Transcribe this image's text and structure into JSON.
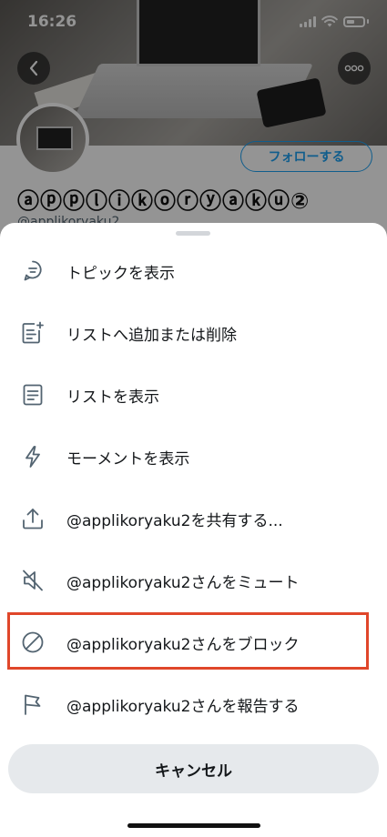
{
  "status_bar": {
    "time": "16:26"
  },
  "profile": {
    "display_name": "ⓐⓟⓟⓛⓘⓚⓞⓡⓨⓐⓚⓤ②",
    "handle": "@applikoryaku2",
    "follow_label": "フォローする",
    "back_icon": "chevron-left-icon",
    "more_icon": "more-horizontal-icon"
  },
  "colors": {
    "accent": "#1da1f2",
    "highlight": "#e0462a",
    "sheet_text": "#14171a",
    "icon_color": "#536471"
  },
  "menu": {
    "items": [
      {
        "label": "トピックを表示",
        "icon": "topic-icon"
      },
      {
        "label": "リストへ追加または削除",
        "icon": "list-add-icon"
      },
      {
        "label": "リストを表示",
        "icon": "list-icon"
      },
      {
        "label": "モーメントを表示",
        "icon": "lightning-icon"
      },
      {
        "label": "@applikoryaku2を共有する...",
        "icon": "share-icon"
      },
      {
        "label": "@applikoryaku2さんをミュート",
        "icon": "mute-icon"
      },
      {
        "label": "@applikoryaku2さんをブロック",
        "icon": "block-icon"
      },
      {
        "label": "@applikoryaku2さんを報告する",
        "icon": "flag-icon"
      }
    ],
    "cancel_label": "キャンセル"
  }
}
